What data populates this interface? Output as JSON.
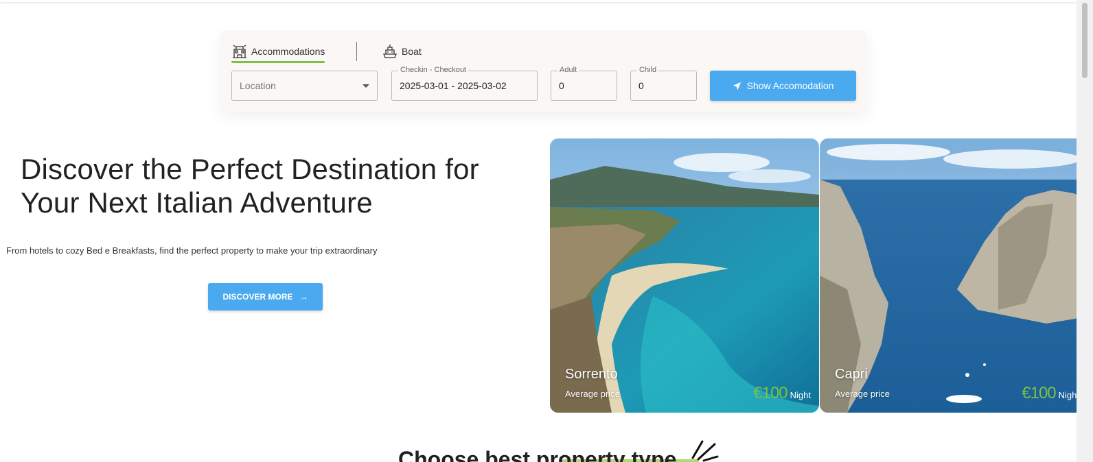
{
  "search": {
    "tabs": [
      {
        "label": "Accommodations",
        "icon": "hotel-icon",
        "active": true
      },
      {
        "label": "Boat",
        "icon": "boat-icon",
        "active": false
      }
    ],
    "location": {
      "placeholder": "Location",
      "value": ""
    },
    "dates": {
      "label": "Checkin - Checkout",
      "value": "2025-03-01 - 2025-03-02"
    },
    "adult": {
      "label": "Adult",
      "value": "0"
    },
    "child": {
      "label": "Child",
      "value": "0"
    },
    "submit_label": "Show Accomodation",
    "submit_icon": "location-arrow-icon"
  },
  "hero": {
    "title": "Discover the Perfect Destination for Your Next Italian Adventure",
    "subtitle": "From hotels to cozy Bed e Breakfasts, find the perfect property to make your trip extraordinary",
    "cta_label": "DISCOVER MORE",
    "cta_icon": "arrow-right-icon"
  },
  "destinations": [
    {
      "name": "Sorrento",
      "avg_label": "Average price",
      "price": "€100",
      "unit": "Night"
    },
    {
      "name": "Capri",
      "avg_label": "Average price",
      "price": "€100",
      "unit": "Night"
    }
  ],
  "section": {
    "title": "Choose best property type"
  },
  "colors": {
    "accent_blue": "#4aa9ef",
    "accent_green": "#7cc142",
    "panel_bg": "#faf7f4"
  }
}
